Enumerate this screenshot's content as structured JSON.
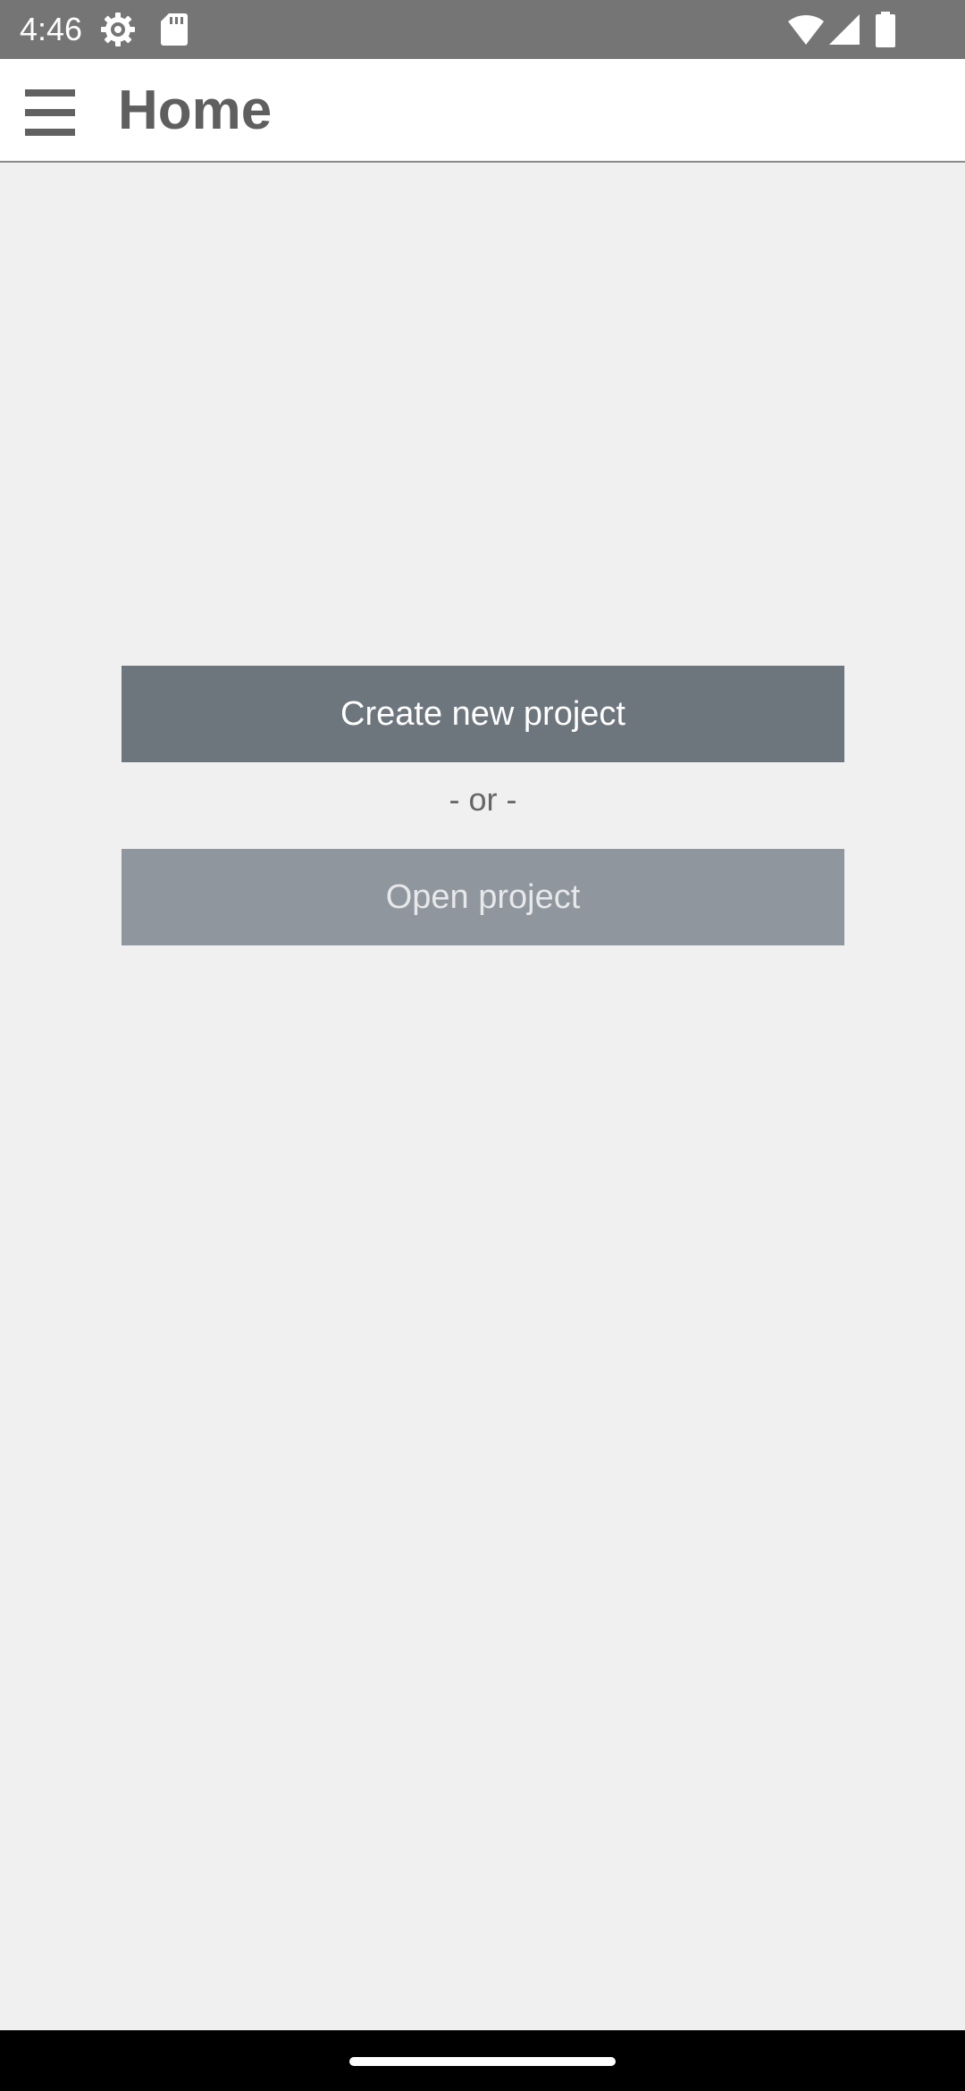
{
  "status_bar": {
    "time": "4:46",
    "icons": [
      "settings-icon",
      "sd-card-icon",
      "wifi-icon",
      "cell-signal-icon",
      "battery-icon"
    ]
  },
  "app_bar": {
    "title": "Home",
    "menu_icon": "menu-icon"
  },
  "main": {
    "create_button_label": "Create new project",
    "separator_text": "- or -",
    "open_button_label": "Open project"
  },
  "colors": {
    "status_bar": "#757575",
    "app_bar": "#ffffff",
    "background": "#f0f0f0",
    "create_button": "#6d757d",
    "open_button": "#8f969d",
    "title_text": "#5f5f5f"
  }
}
